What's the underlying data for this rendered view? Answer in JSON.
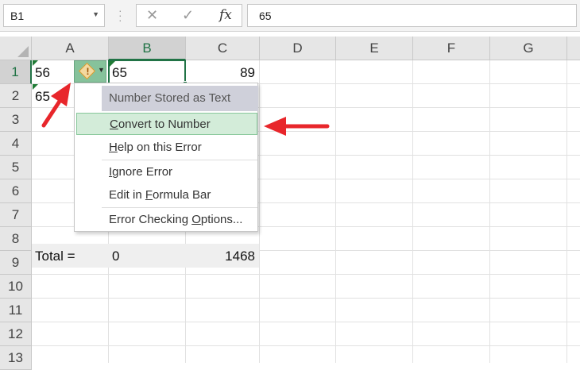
{
  "formula_bar": {
    "name_box": "B1",
    "fx_label": "fx",
    "cancel_glyph": "✕",
    "enter_glyph": "✓",
    "formula_value": "65"
  },
  "columns": [
    "A",
    "B",
    "C",
    "D",
    "E",
    "F",
    "G"
  ],
  "rows": [
    "1",
    "2",
    "3",
    "4",
    "5",
    "6",
    "7",
    "8",
    "9",
    "10",
    "11",
    "12",
    "13"
  ],
  "cells": {
    "a1": "56",
    "b1": "65",
    "c1": "89",
    "a2": "65",
    "a9": "Total =",
    "b9": "0",
    "c9": "1468"
  },
  "error_menu": {
    "title": "Number Stored as Text",
    "items": [
      {
        "pre": "",
        "u": "C",
        "post": "onvert to Number"
      },
      {
        "pre": "",
        "u": "H",
        "post": "elp on this Error"
      },
      {
        "pre": "",
        "u": "I",
        "post": "gnore Error"
      },
      {
        "pre": "Edit in ",
        "u": "F",
        "post": "ormula Bar"
      },
      {
        "pre": "Error Checking ",
        "u": "O",
        "post": "ptions..."
      }
    ]
  },
  "colors": {
    "excel_green": "#217346",
    "annotation_red": "#e8262b",
    "highlight": "#d3ecd9"
  },
  "icons": {
    "error": "warning-diamond-icon",
    "dropdown": "chevron-down-icon"
  }
}
